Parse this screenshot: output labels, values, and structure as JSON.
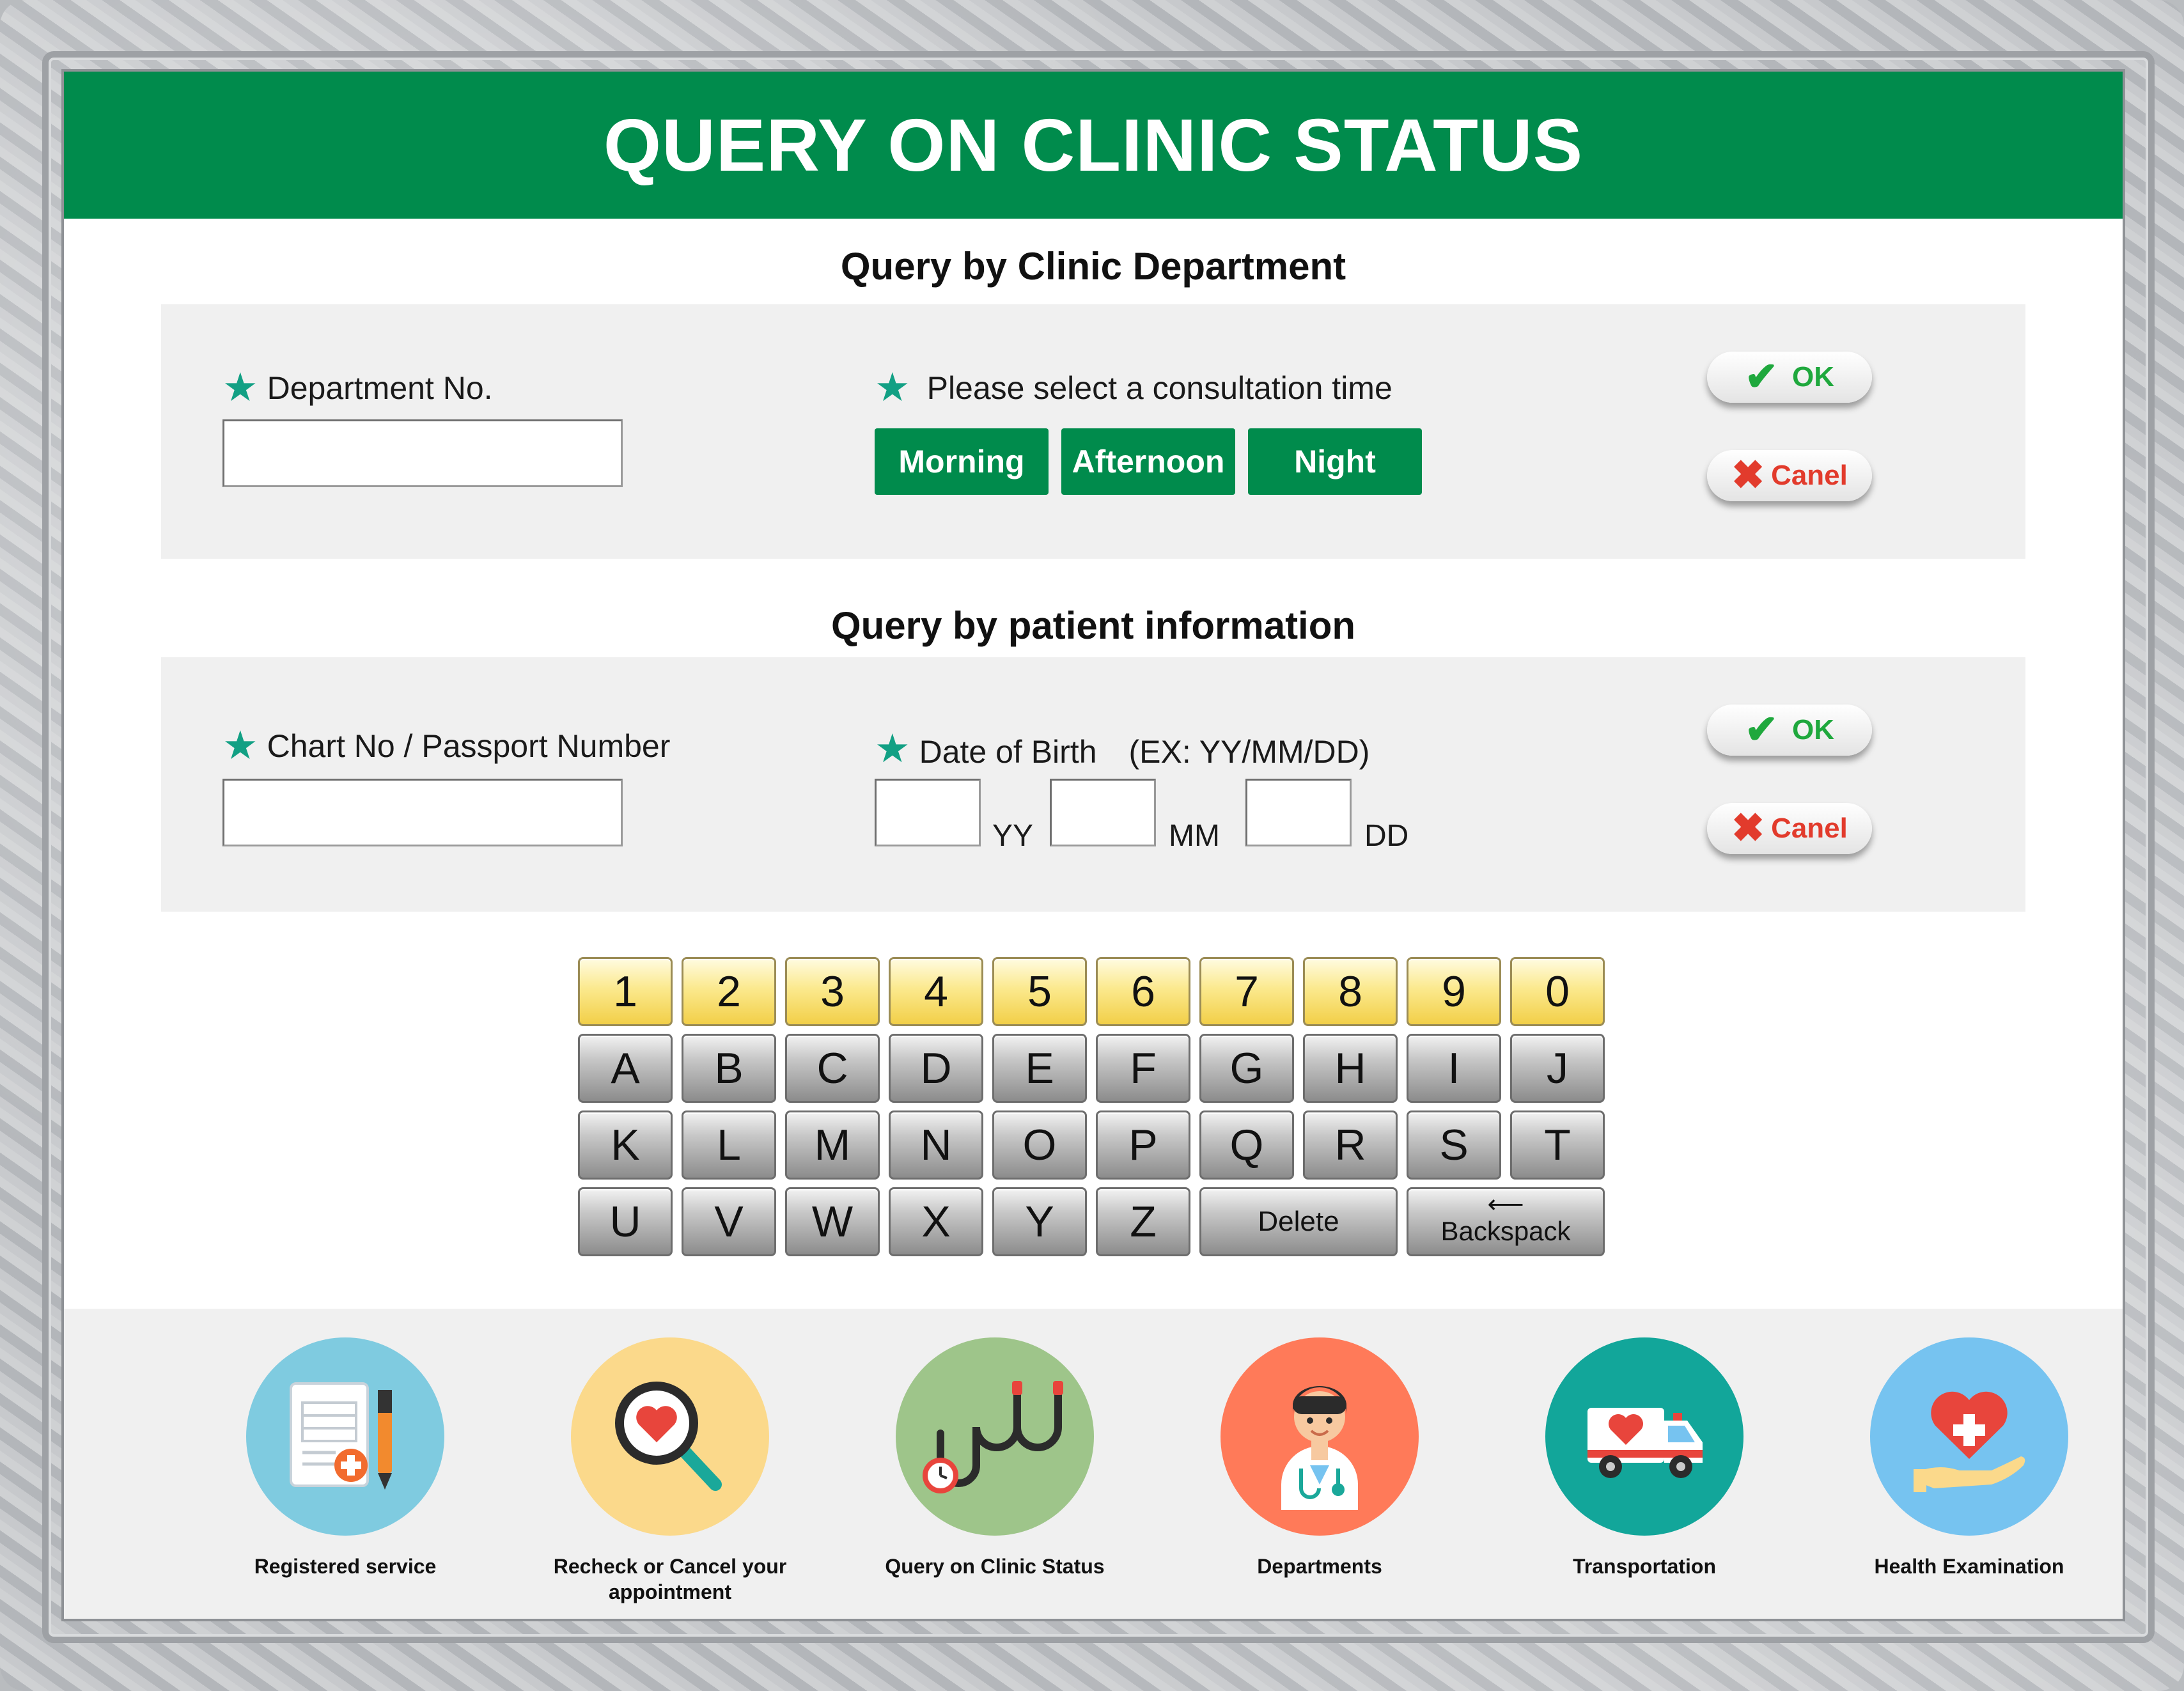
{
  "header": {
    "title": "QUERY ON CLINIC STATUS"
  },
  "department_section": {
    "title": "Query by Clinic Department",
    "department_label": "Department  No.",
    "department_value": "",
    "time_label": "Please select a consultation time",
    "time_options": [
      "Morning",
      "Afternoon",
      "Night"
    ],
    "ok_label": "OK",
    "cancel_label": "Canel"
  },
  "patient_section": {
    "title": "Query by patient information",
    "chart_label": "Chart No / Passport Number",
    "chart_value": "",
    "dob_label": "Date of Birth　(EX: YY/MM/DD)",
    "units": {
      "yy": "YY",
      "mm": "MM",
      "dd": "DD"
    },
    "ok_label": "OK",
    "cancel_label": "Canel"
  },
  "keyboard": {
    "row1": [
      "1",
      "2",
      "3",
      "4",
      "5",
      "6",
      "7",
      "8",
      "9",
      "0"
    ],
    "row2": [
      "A",
      "B",
      "C",
      "D",
      "E",
      "F",
      "G",
      "H",
      "I",
      "J"
    ],
    "row3": [
      "K",
      "L",
      "M",
      "N",
      "O",
      "P",
      "Q",
      "R",
      "S",
      "T"
    ],
    "row4": [
      "U",
      "V",
      "W",
      "X",
      "Y",
      "Z"
    ],
    "delete_label": "Delete",
    "backspace_label": "Backspack"
  },
  "bottom_nav": {
    "items": [
      {
        "label": "Registered service",
        "icon": "document-pen-icon",
        "color": "#7fcbe0"
      },
      {
        "label": "Recheck or Cancel your appointment",
        "icon": "magnifier-heart-icon",
        "color": "#fbd98b"
      },
      {
        "label": "Query on Clinic Status",
        "icon": "stethoscope-icon",
        "color": "#9ec58a"
      },
      {
        "label": "Departments",
        "icon": "doctor-icon",
        "color": "#ff7a59"
      },
      {
        "label": "Transportation",
        "icon": "ambulance-icon",
        "color": "#12a69a"
      },
      {
        "label": "Health Examination",
        "icon": "heart-hand-icon",
        "color": "#76c3f0"
      }
    ]
  },
  "colors": {
    "brand_green": "#008b4c",
    "star_teal": "#12a084",
    "ok_green": "#1fa83d",
    "cancel_red": "#e23b2c",
    "number_key_yellow": "#f7dd6a"
  }
}
